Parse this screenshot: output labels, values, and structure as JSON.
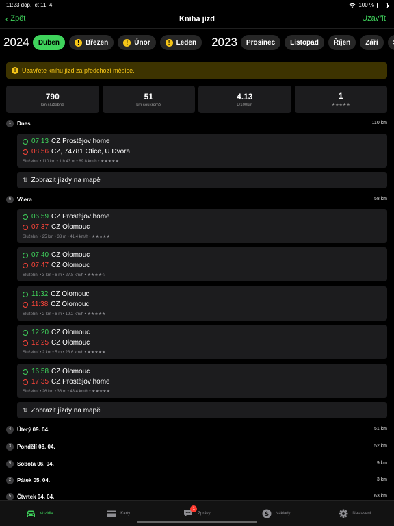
{
  "status_bar": {
    "time": "11:23 dop.",
    "date": "čt 11. 4.",
    "battery": "100 %"
  },
  "nav": {
    "back_label": "Zpět",
    "title": "Kniha jízd",
    "close_label": "Uzavřít"
  },
  "months": {
    "year_current": "2024",
    "year_previous": "2023",
    "current_year_months": [
      {
        "label": "Duben",
        "active": true,
        "warning": false
      },
      {
        "label": "Březen",
        "active": false,
        "warning": true
      },
      {
        "label": "Únor",
        "active": false,
        "warning": true
      },
      {
        "label": "Leden",
        "active": false,
        "warning": true
      }
    ],
    "previous_year_months": [
      "Prosinec",
      "Listopad",
      "Říjen",
      "Září",
      "Srpen"
    ]
  },
  "banner": {
    "text": "Uzavřete knihu jízd za předchozí měsíce.",
    "icon": "warning-icon"
  },
  "stats": [
    {
      "value": "790",
      "label": "km služebně"
    },
    {
      "value": "51",
      "label": "km soukromě"
    },
    {
      "value": "4.13",
      "label": "L/100km"
    },
    {
      "value": "1",
      "label": "★★★★★"
    }
  ],
  "days": [
    {
      "count": "1",
      "name": "Dnes",
      "distance": "110 km"
    },
    {
      "count": "6",
      "name": "Včera",
      "distance": "58 km"
    },
    {
      "count": "4",
      "name": "Úterý 09. 04.",
      "distance": "51 km"
    },
    {
      "count": "3",
      "name": "Pondělí 08. 04.",
      "distance": "52 km"
    },
    {
      "count": "5",
      "name": "Sobota 06. 04.",
      "distance": "9 km"
    },
    {
      "count": "2",
      "name": "Pátek 05. 04.",
      "distance": "3 km"
    },
    {
      "count": "5",
      "name": "Čtvrtek 04. 04.",
      "distance": "63 km"
    }
  ],
  "trips": [
    {
      "start_time": "07:13",
      "start_place": "CZ Prostějov home",
      "end_time": "08:56",
      "end_place": "CZ, 74781 Otice, U Dvora",
      "meta": "Služební • 110 km • 1 h 43 m • 69.8 km/h • ★★★★★"
    },
    {
      "start_time": "06:59",
      "start_place": "CZ Prostějov home",
      "end_time": "07:37",
      "end_place": "CZ Olomouc",
      "meta": "Služební • 25 km • 38 m • 41.4 km/h • ★★★★★"
    },
    {
      "start_time": "07:40",
      "start_place": "CZ Olomouc",
      "end_time": "07:47",
      "end_place": "CZ Olomouc",
      "meta": "Služební • 3 km • 6 m • 27.8 km/h • ★★★★☆"
    },
    {
      "start_time": "11:32",
      "start_place": "CZ Olomouc",
      "end_time": "11:38",
      "end_place": "CZ Olomouc",
      "meta": "Služební • 2 km • 6 m • 19.2 km/h • ★★★★★"
    },
    {
      "start_time": "12:20",
      "start_place": "CZ Olomouc",
      "end_time": "12:25",
      "end_place": "CZ Olomouc",
      "meta": "Služební • 2 km • 5 m • 23.6 km/h • ★★★★★"
    },
    {
      "start_time": "16:58",
      "start_place": "CZ Olomouc",
      "end_time": "17:35",
      "end_place": "CZ Prostějov home",
      "meta": "Služební • 26 km • 36 m • 43.4 km/h • ★★★★★"
    }
  ],
  "map_button_label": "Zobrazit jízdy na mapě",
  "tabbar": [
    {
      "label": "Vozidla",
      "icon": "car-icon",
      "active": true
    },
    {
      "label": "Karty",
      "icon": "card-icon",
      "active": false
    },
    {
      "label": "Zprávy",
      "icon": "chat-icon",
      "active": false,
      "badge": "1"
    },
    {
      "label": "Náklady",
      "icon": "dollar-icon",
      "active": false
    },
    {
      "label": "Nastavení",
      "icon": "gear-icon",
      "active": false
    }
  ],
  "colors": {
    "accent": "#3fd35c",
    "end": "#ff453a",
    "warning": "#f5c518"
  }
}
